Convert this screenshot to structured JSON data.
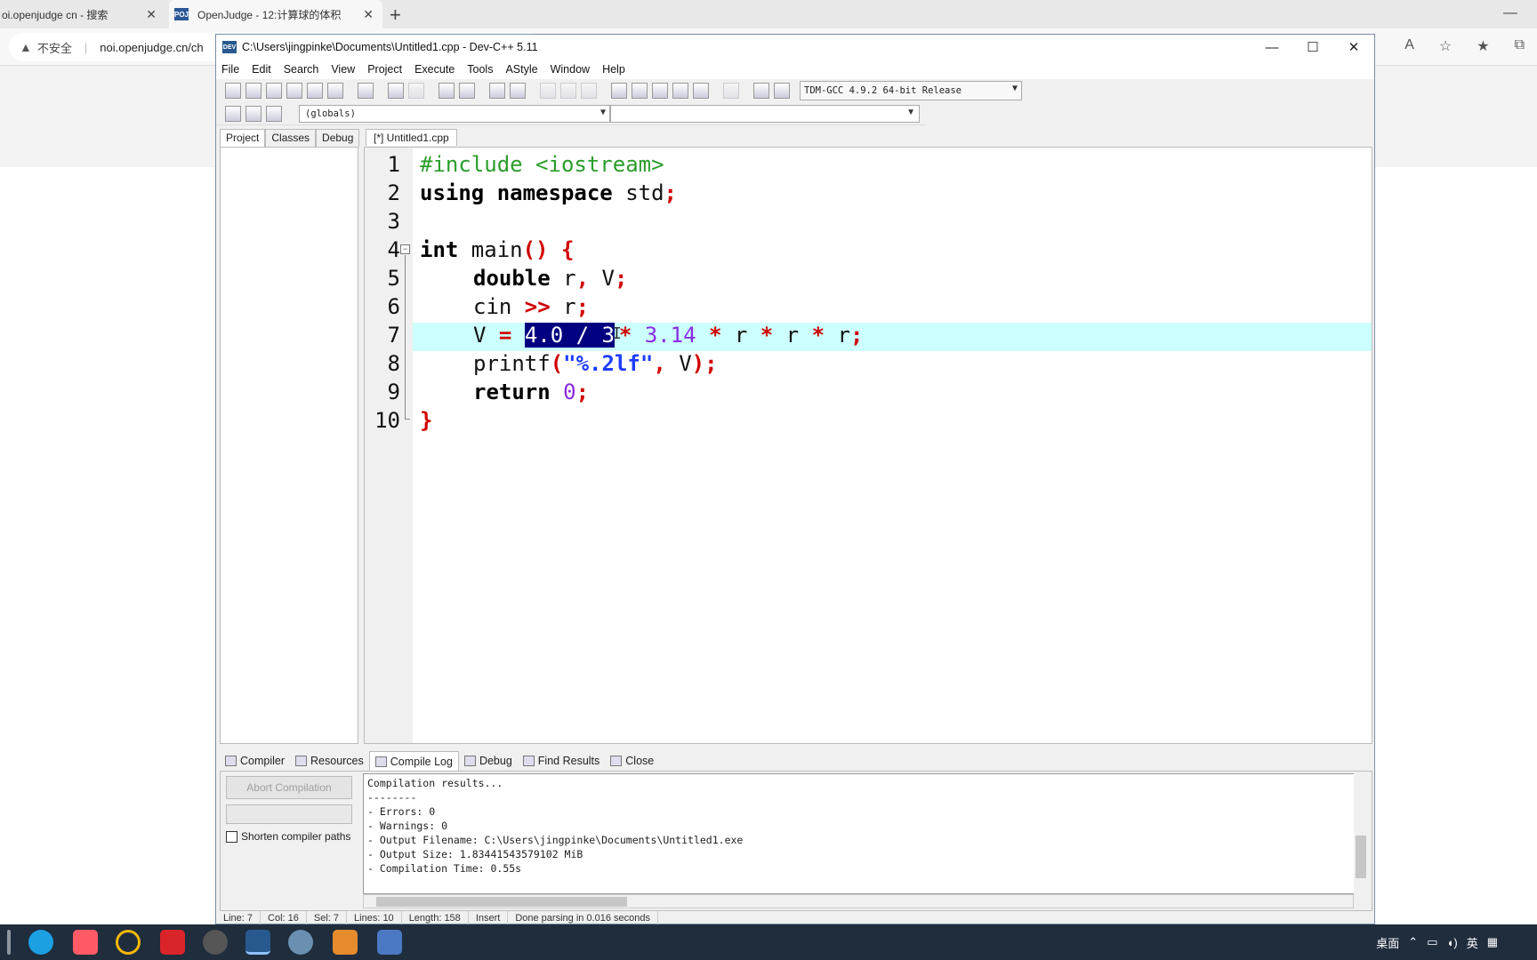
{
  "browser": {
    "tabs": [
      {
        "label": "oi.openjudge cn - 搜索"
      },
      {
        "label": "OpenJudge - 12:计算球的体积"
      }
    ],
    "address_warning": "不安全",
    "address": "noi.openjudge.cn/ch"
  },
  "window": {
    "title": "C:\\Users\\jingpinke\\Documents\\Untitled1.cpp - Dev-C++ 5.11"
  },
  "menu": [
    "File",
    "Edit",
    "Search",
    "View",
    "Project",
    "Execute",
    "Tools",
    "AStyle",
    "Window",
    "Help"
  ],
  "toolbar": {
    "compiler": "TDM-GCC 4.9.2 64-bit Release",
    "scope": "(globals)"
  },
  "left_tabs": [
    "Project",
    "Classes",
    "Debug"
  ],
  "editor_tab": "[*] Untitled1.cpp",
  "line_numbers": [
    "1",
    "2",
    "3",
    "4",
    "5",
    "6",
    "7",
    "8",
    "9",
    "10"
  ],
  "code": {
    "l1": "#include <iostream>",
    "l2_kw": "using namespace",
    "l2_rest": " std",
    "l2_semi": ";",
    "l4_kw": "int",
    "l4_name": " main",
    "l4_paren": "()",
    "l4_brace": " {",
    "l5_kw": "double",
    "l5_a": " r",
    ",": ",",
    "l5_b": " V",
    "semi": ";",
    "l6_a": "cin ",
    "l6_op": ">>",
    "l6_b": " r",
    "l7_a": "V ",
    "l7_eq": "=",
    "l7_sp": " ",
    "l7_sel": "4.0 / 3",
    "l7_star": "* ",
    "l7_num": "3.14",
    "l7_rest1": " ",
    "l7_s2": "*",
    "l7_r1": " r ",
    "l7_s3": "*",
    "l7_r2": " r ",
    "l7_s4": "*",
    "l7_r3": " r",
    "l8_a": "printf",
    "l8_p": "(",
    "l8_str": "\"%.2lf\"",
    "l8_c": ",",
    "l8_v": " V",
    "l8_end": ");",
    "l9_kw": "return",
    "l9_num": " 0",
    "l10": "}"
  },
  "bottom_tabs": [
    "Compiler",
    "Resources",
    "Compile Log",
    "Debug",
    "Find Results",
    "Close"
  ],
  "abort_label": "Abort Compilation",
  "shorten_label": "Shorten compiler paths",
  "log": [
    "Compilation results...",
    "--------",
    "- Errors: 0",
    "- Warnings: 0",
    "- Output Filename: C:\\Users\\jingpinke\\Documents\\Untitled1.exe",
    "- Output Size: 1.83441543579102 MiB",
    "- Compilation Time: 0.55s"
  ],
  "status": {
    "line": "Line:    7",
    "col": "Col:    16",
    "sel": "Sel:    7",
    "lines": "Lines:    10",
    "length": "Length:    158",
    "mode": "Insert",
    "msg": "Done parsing in 0.016 seconds"
  },
  "tray": {
    "desktop": "桌面",
    "ime": "英"
  }
}
